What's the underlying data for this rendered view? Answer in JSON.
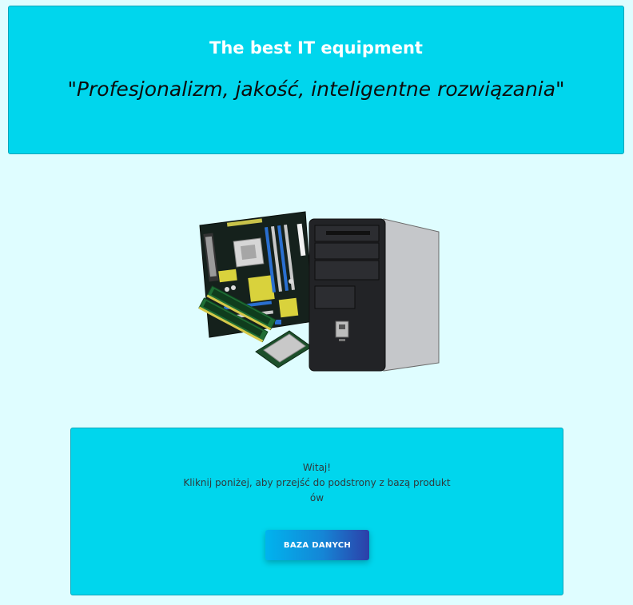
{
  "header": {
    "title": "The best IT equipment",
    "motto": "\"Profesjonalizm, jakość, inteligentne rozwiązania\""
  },
  "hero": {
    "image_name": "computer-hardware-illustration"
  },
  "welcome": {
    "greeting": "Witaj!",
    "message": "Kliknij poniżej, aby przejść do podstrony z bazą produktów",
    "button_label": "BAZA DANYCH"
  },
  "colors": {
    "page_background": "#dffdff",
    "box_background": "#00d6ed",
    "button_gradient_start": "#00b4ee",
    "button_gradient_end": "#2c3fa8"
  }
}
